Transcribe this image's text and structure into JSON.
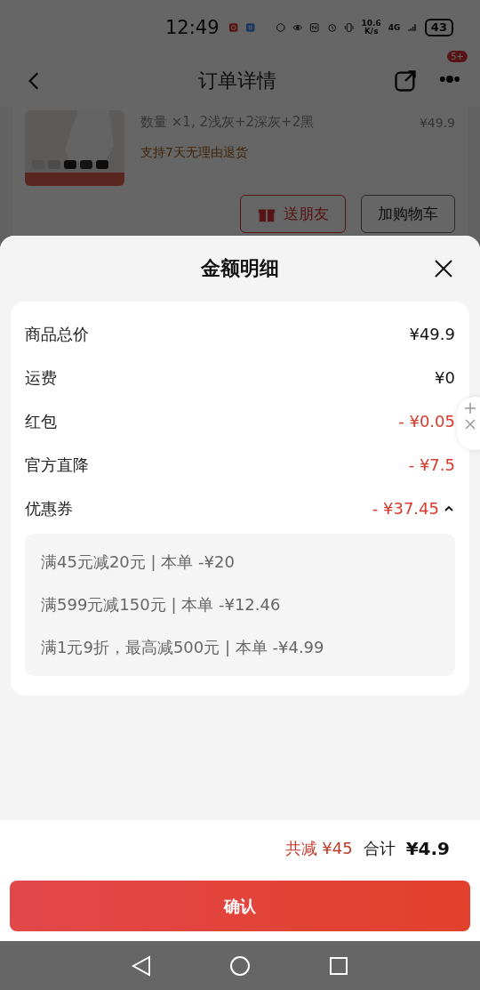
{
  "status_bar": {
    "time": "12:49",
    "net_speed": "10.6",
    "net_unit": "K/s",
    "network": "4G",
    "battery": "43"
  },
  "header": {
    "title": "订单详情",
    "badge": "5+"
  },
  "product": {
    "spec": "数量 ×1, 2浅灰+2深灰+2黑",
    "price": "¥49.9",
    "return_policy": "支持7天无理由退货",
    "buttons": [
      {
        "kind": "gift",
        "label": "送朋友"
      },
      {
        "kind": "plain",
        "label": "加购物车"
      }
    ]
  },
  "sheet": {
    "title": "金额明细",
    "rows": [
      {
        "label": "商品总价",
        "value": "¥49.9",
        "kind": "normal"
      },
      {
        "label": "运费",
        "value": "¥0",
        "kind": "normal"
      },
      {
        "label": "红包",
        "value": "- ¥0.05",
        "kind": "discount"
      },
      {
        "label": "官方直降",
        "value": "- ¥7.5",
        "kind": "discount"
      },
      {
        "label": "优惠券",
        "value": "- ¥37.45",
        "kind": "discount",
        "expanded": true
      }
    ],
    "coupons": [
      "满45元减20元 | 本单 -¥20",
      "满599元减150元 | 本单 -¥12.46",
      "满1元9折，最高减500元 | 本单 -¥4.99"
    ],
    "total_saved": "共减 ¥45",
    "total_label": "合计",
    "total": "¥4.9",
    "confirm": "确认"
  }
}
